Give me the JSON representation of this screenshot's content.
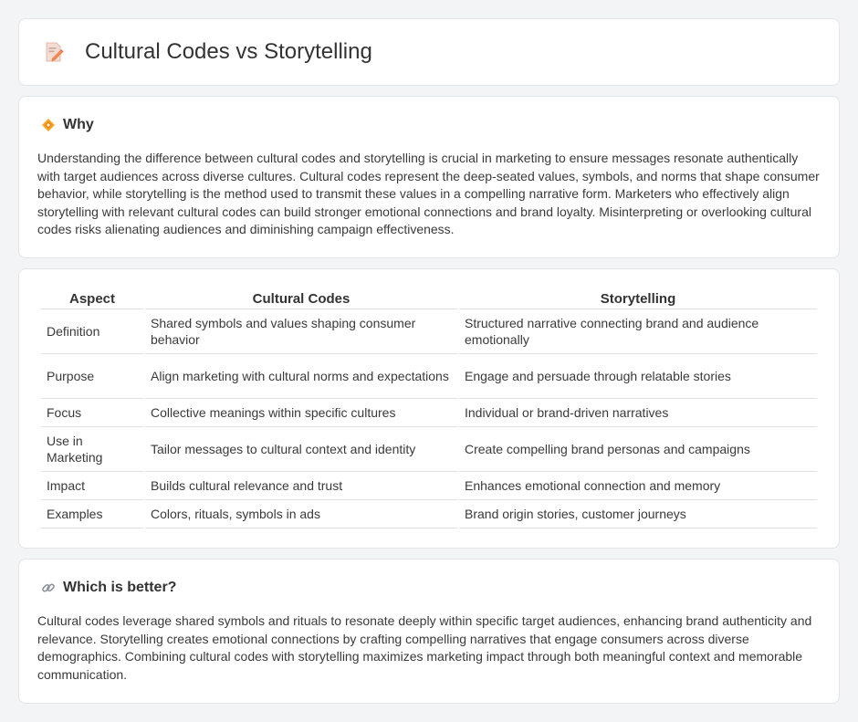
{
  "header": {
    "title": "Cultural Codes vs Storytelling",
    "icon": "document-pencil-icon"
  },
  "why": {
    "icon": "diamond-icon",
    "title": "Why",
    "body": "Understanding the difference between cultural codes and storytelling is crucial in marketing to ensure messages resonate authentically with target audiences across diverse cultures. Cultural codes represent the deep-seated values, symbols, and norms that shape consumer behavior, while storytelling is the method used to transmit these values in a compelling narrative form. Marketers who effectively align storytelling with relevant cultural codes can build stronger emotional connections and brand loyalty. Misinterpreting or overlooking cultural codes risks alienating audiences and diminishing campaign effectiveness."
  },
  "table": {
    "headers": [
      "Aspect",
      "Cultural Codes",
      "Storytelling"
    ],
    "rows": [
      [
        "Definition",
        "Shared symbols and values shaping consumer behavior",
        "Structured narrative connecting brand and audience emotionally"
      ],
      [
        "Purpose",
        "Align marketing with cultural norms and expectations",
        "Engage and persuade through relatable stories"
      ],
      [
        "Focus",
        "Collective meanings within specific cultures",
        "Individual or brand-driven narratives"
      ],
      [
        "Use in Marketing",
        "Tailor messages to cultural context and identity",
        "Create compelling brand personas and campaigns"
      ],
      [
        "Impact",
        "Builds cultural relevance and trust",
        "Enhances emotional connection and memory"
      ],
      [
        "Examples",
        "Colors, rituals, symbols in ads",
        "Brand origin stories, customer journeys"
      ]
    ]
  },
  "better": {
    "icon": "link-icon",
    "title": "Which is better?",
    "body": "Cultural codes leverage shared symbols and rituals to resonate deeply within specific target audiences, enhancing brand authenticity and relevance. Storytelling creates emotional connections by crafting compelling narratives that engage consumers across diverse demographics. Combining cultural codes with storytelling maximizes marketing impact through both meaningful context and memorable communication."
  }
}
